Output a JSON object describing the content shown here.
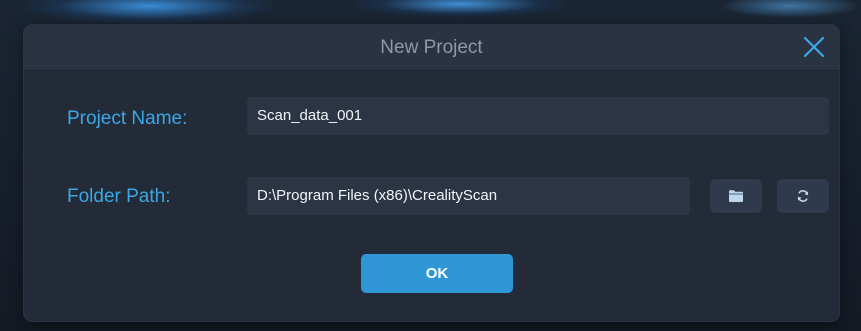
{
  "dialog": {
    "title": "New Project",
    "close_icon": "close-icon"
  },
  "form": {
    "project_name_label": "Project Name:",
    "project_name_value": "Scan_data_001",
    "folder_path_label": "Folder Path:",
    "folder_path_value": "D:\\Program Files (x86)\\CrealityScan",
    "browse_icon": "folder-icon",
    "reset_icon": "refresh-icon"
  },
  "actions": {
    "ok_label": "OK"
  },
  "colors": {
    "accent": "#3aa7e6",
    "button": "#2f97d6",
    "dialog_bg": "#232b38",
    "title_bar_bg": "#2a3341",
    "input_bg": "#2c3543"
  }
}
